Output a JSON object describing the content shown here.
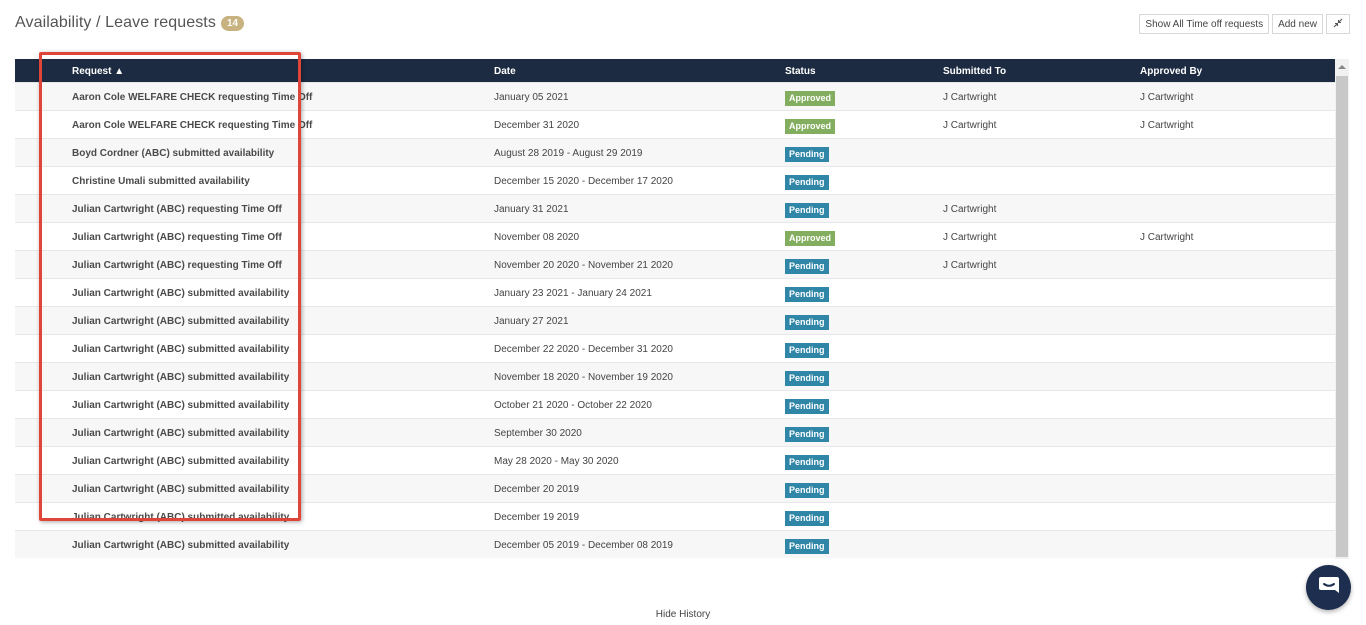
{
  "header": {
    "title": "Availability / Leave requests",
    "count": "14"
  },
  "toolbar": {
    "show_all_label": "Show All Time off requests",
    "add_new_label": "Add new",
    "collapse_icon": "compress-icon"
  },
  "table": {
    "columns": {
      "request": "Request ▲",
      "date": "Date",
      "status": "Status",
      "submitted_to": "Submitted To",
      "approved_by": "Approved By"
    },
    "rows": [
      {
        "request": "Aaron Cole WELFARE CHECK requesting Time Off",
        "date": "January 05 2021",
        "status": "Approved",
        "submitted_to": "J Cartwright",
        "approved_by": "J Cartwright"
      },
      {
        "request": "Aaron Cole WELFARE CHECK requesting Time Off",
        "date": "December 31 2020",
        "status": "Approved",
        "submitted_to": "J Cartwright",
        "approved_by": "J Cartwright"
      },
      {
        "request": "Boyd Cordner (ABC) submitted availability",
        "date": "August 28 2019 - August 29 2019",
        "status": "Pending",
        "submitted_to": "",
        "approved_by": ""
      },
      {
        "request": "Christine Umali submitted availability",
        "date": "December 15 2020 - December 17 2020",
        "status": "Pending",
        "submitted_to": "",
        "approved_by": ""
      },
      {
        "request": "Julian Cartwright (ABC) requesting Time Off",
        "date": "January 31 2021",
        "status": "Pending",
        "submitted_to": "J Cartwright",
        "approved_by": ""
      },
      {
        "request": "Julian Cartwright (ABC) requesting Time Off",
        "date": "November 08 2020",
        "status": "Approved",
        "submitted_to": "J Cartwright",
        "approved_by": "J Cartwright"
      },
      {
        "request": "Julian Cartwright (ABC) requesting Time Off",
        "date": "November 20 2020 - November 21 2020",
        "status": "Pending",
        "submitted_to": "J Cartwright",
        "approved_by": ""
      },
      {
        "request": "Julian Cartwright (ABC) submitted availability",
        "date": "January 23 2021 - January 24 2021",
        "status": "Pending",
        "submitted_to": "",
        "approved_by": ""
      },
      {
        "request": "Julian Cartwright (ABC) submitted availability",
        "date": "January 27 2021",
        "status": "Pending",
        "submitted_to": "",
        "approved_by": ""
      },
      {
        "request": "Julian Cartwright (ABC) submitted availability",
        "date": "December 22 2020 - December 31 2020",
        "status": "Pending",
        "submitted_to": "",
        "approved_by": ""
      },
      {
        "request": "Julian Cartwright (ABC) submitted availability",
        "date": "November 18 2020 - November 19 2020",
        "status": "Pending",
        "submitted_to": "",
        "approved_by": ""
      },
      {
        "request": "Julian Cartwright (ABC) submitted availability",
        "date": "October 21 2020 - October 22 2020",
        "status": "Pending",
        "submitted_to": "",
        "approved_by": ""
      },
      {
        "request": "Julian Cartwright (ABC) submitted availability",
        "date": "September 30 2020",
        "status": "Pending",
        "submitted_to": "",
        "approved_by": ""
      },
      {
        "request": "Julian Cartwright (ABC) submitted availability",
        "date": "May 28 2020 - May 30 2020",
        "status": "Pending",
        "submitted_to": "",
        "approved_by": ""
      },
      {
        "request": "Julian Cartwright (ABC) submitted availability",
        "date": "December 20 2019",
        "status": "Pending",
        "submitted_to": "",
        "approved_by": ""
      },
      {
        "request": "Julian Cartwright (ABC) submitted availability",
        "date": "December 19 2019",
        "status": "Pending",
        "submitted_to": "",
        "approved_by": ""
      },
      {
        "request": "Julian Cartwright (ABC) submitted availability",
        "date": "December 05 2019 - December 08 2019",
        "status": "Pending",
        "submitted_to": "",
        "approved_by": ""
      }
    ]
  },
  "footer": {
    "hide_history_label": "Hide History"
  },
  "colors": {
    "header_bg": "#1c2b41",
    "approved": "#84ae5f",
    "pending": "#2f86a6",
    "highlight": "#e0453a",
    "count_badge": "#c8b27f"
  },
  "icons": {
    "chat": "chat-icon",
    "scroll_up": "scroll-up-arrow-icon"
  }
}
